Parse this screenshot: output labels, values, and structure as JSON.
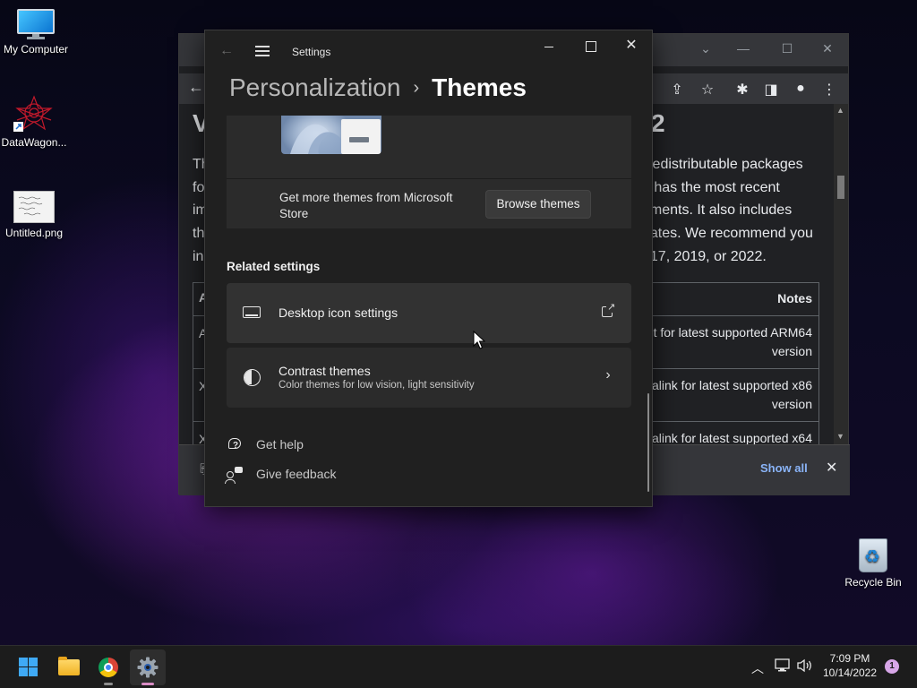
{
  "desktop": {
    "icons": [
      {
        "label": "My Computer",
        "icon": "monitor-icon"
      },
      {
        "label": "DataWagon...",
        "icon": "datawagon-logo-icon"
      },
      {
        "label": "Untitled.png",
        "icon": "png-file-icon"
      },
      {
        "label": "Recycle Bin",
        "icon": "recycle-bin-icon"
      }
    ]
  },
  "browser": {
    "heading_left": "V",
    "heading_right": "2",
    "para_left": [
      "Th",
      "fo",
      "im",
      "th",
      "in"
    ],
    "para_right": [
      "Redistributable packages",
      "n has the most recent",
      "ements. It also includes",
      "dates. We recommend you",
      "017, 2019, or 2022."
    ],
    "table": {
      "left_col": [
        "A",
        "A",
        "X",
        "X"
      ],
      "notes_header": "Notes",
      "rows": [
        [
          "t for latest supported ARM64",
          "version"
        ],
        [
          "alink for latest supported x86",
          "version"
        ],
        [
          "alink for latest supported x64"
        ]
      ]
    },
    "download_bar": {
      "show_all": "Show all",
      "close": "✕"
    }
  },
  "settings": {
    "window_title": "Settings",
    "breadcrumb": {
      "parent": "Personalization",
      "separator": "›",
      "current": "Themes"
    },
    "get_more_text": "Get more themes from Microsoft Store",
    "browse_button": "Browse themes",
    "related_heading": "Related settings",
    "rows": [
      {
        "label": "Desktop icon settings",
        "icon": "laptop-icon",
        "action": "external-link-icon"
      },
      {
        "label": "Contrast themes",
        "sublabel": "Color themes for low vision, light sensitivity",
        "icon": "contrast-icon",
        "action": "chevron-right-icon"
      }
    ],
    "help_links": [
      {
        "label": "Get help",
        "icon": "help-icon"
      },
      {
        "label": "Give feedback",
        "icon": "feedback-icon"
      }
    ]
  },
  "taskbar": {
    "apps": [
      "start",
      "file-explorer",
      "chrome",
      "settings"
    ],
    "clock_time": "7:09 PM",
    "clock_date": "10/14/2022",
    "notification_count": "1"
  },
  "colors": {
    "settings_bg": "#202020",
    "card_bg": "#2b2b2b",
    "accent_blue": "#3fa9f5",
    "link_blue": "#8ab4f8"
  }
}
